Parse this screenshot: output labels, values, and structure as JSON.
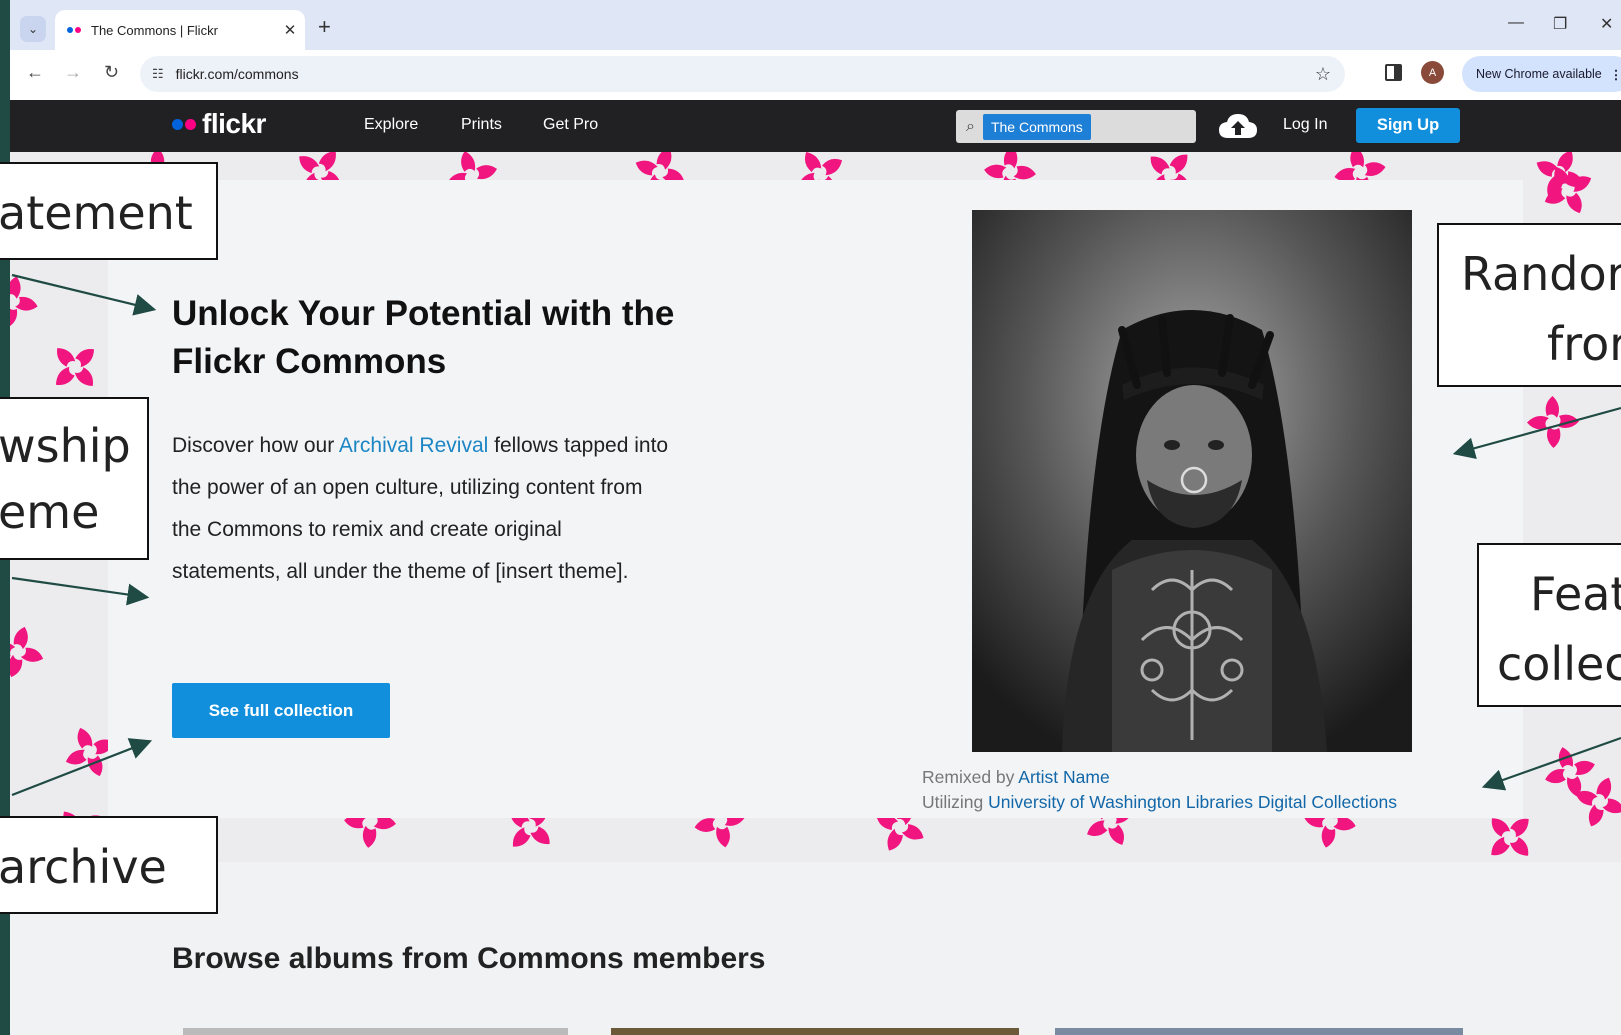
{
  "browser": {
    "tab_title": "The Commons | Flickr",
    "url": "flickr.com/commons",
    "profile_initial": "A",
    "update_label": "New Chrome available"
  },
  "nav": {
    "logo": "flickr",
    "links": [
      "Explore",
      "Prints",
      "Get Pro"
    ],
    "search_chip": "The Commons",
    "login": "Log In",
    "signup": "Sign Up"
  },
  "hero": {
    "headline_line1": "Unlock Your Potential with the",
    "headline_line2": "Flickr Commons",
    "desc_before": "Discover how our ",
    "desc_link": "Archival Revival",
    "desc_after": " fellows tapped into the power of an open culture, utilizing content from the Commons to remix and create original statements, all under the theme of [insert theme].",
    "cta": "See full collection",
    "caption_remixed_prefix": "Remixed by ",
    "caption_artist": "Artist Name",
    "caption_util_prefix": "Utilizing ",
    "caption_collection": "University of Washington Libraries Digital Collections"
  },
  "browse": {
    "heading": "Browse albums from Commons members"
  },
  "annotations": {
    "statement": "atement",
    "fellowship_line1": "wship",
    "fellowship_line2": "eme",
    "archive": "archive",
    "random_line1": "Randor",
    "random_line2": "fror",
    "featured_line1": "Feat",
    "featured_line2": "collec"
  },
  "colors": {
    "flickr_blue": "#0063dc",
    "flickr_pink": "#ff0084",
    "button_blue": "#128fdc",
    "link_blue": "#1c86c4",
    "pattern_pink": "#f0157f"
  }
}
